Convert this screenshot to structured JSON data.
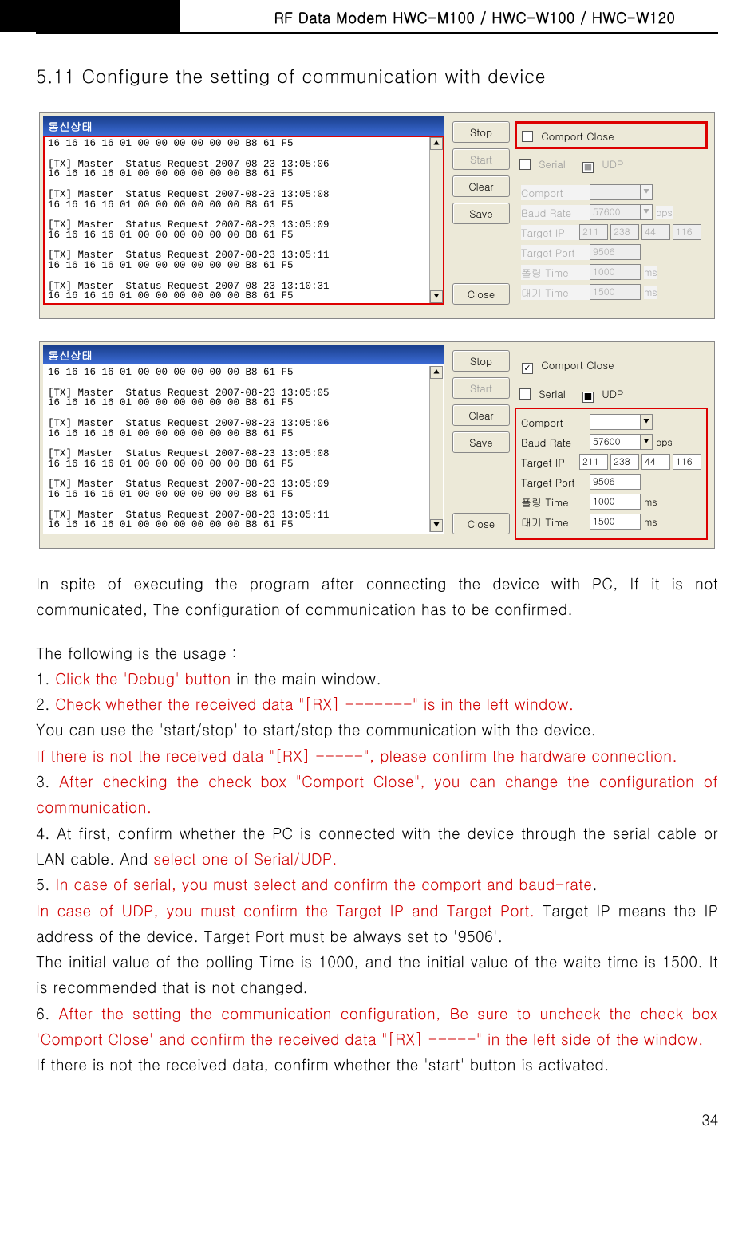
{
  "header": {
    "title": "RF Data Modem HWC-M100 / HWC-W100 / HWC-W120"
  },
  "section_title": "5.11 Configure the setting of communication with device",
  "log_panel_title": "통신상태",
  "log1": "16 16 16 16 01 00 00 00 00 00 00 B8 61 F5\n\n[TX] Master  Status Request 2007-08-23 13:05:06\n16 16 16 16 01 00 00 00 00 00 00 B8 61 F5\n\n[TX] Master  Status Request 2007-08-23 13:05:08\n16 16 16 16 01 00 00 00 00 00 00 B8 61 F5\n\n[TX] Master  Status Request 2007-08-23 13:05:09\n16 16 16 16 01 00 00 00 00 00 00 B8 61 F5\n\n[TX] Master  Status Request 2007-08-23 13:05:11\n16 16 16 16 01 00 00 00 00 00 00 B8 61 F5\n\n[TX] Master  Status Request 2007-08-23 13:10:31\n16 16 16 16 01 00 00 00 00 00 00 B8 61 F5",
  "log2": "16 16 16 16 01 00 00 00 00 00 00 B8 61 F5\n\n[TX] Master  Status Request 2007-08-23 13:05:05\n16 16 16 16 01 00 00 00 00 00 00 B8 61 F5\n\n[TX] Master  Status Request 2007-08-23 13:05:06\n16 16 16 16 01 00 00 00 00 00 00 B8 61 F5\n\n[TX] Master  Status Request 2007-08-23 13:05:08\n16 16 16 16 01 00 00 00 00 00 00 B8 61 F5\n\n[TX] Master  Status Request 2007-08-23 13:05:09\n16 16 16 16 01 00 00 00 00 00 00 B8 61 F5\n\n[TX] Master  Status Request 2007-08-23 13:05:11\n16 16 16 16 01 00 00 00 00 00 00 B8 61 F5",
  "buttons": {
    "stop": "Stop",
    "start": "Start",
    "clear": "Clear",
    "save": "Save",
    "close": "Close"
  },
  "settings": {
    "comport_close": "Comport Close",
    "serial": "Serial",
    "udp": "UDP",
    "comport": "Comport",
    "baud": "Baud Rate",
    "baud_val": "57600",
    "bps": "bps",
    "target_ip": "Target IP",
    "ip": [
      "211",
      "238",
      "44",
      "116"
    ],
    "target_port": "Target Port",
    "port_val": "9506",
    "poll_time": "폴링 Time",
    "poll_val": "1000",
    "wait_time": "대기 Time",
    "wait_val": "1500",
    "ms": "ms"
  },
  "para": {
    "p1a": "In  spite  of  executing  the  program  after  connecting  the  device  with  PC,  If  it  is  not communicated, The configuration of communication has to be confirmed.",
    "p2": "The following is the usage :",
    "p3a": "1. ",
    "p3b": "Click the 'Debug' button",
    "p3c": " in the main window.",
    "p4a": "2. ",
    "p4b": "Check whether the received data \"[RX] -------\" is in the left window.",
    "p5": "   You can use the 'start/stop' to start/stop the communication with the device.",
    "p6": "   If there is not the received data \"[RX] -----\", please confirm the hardware connection.",
    "p7a": "3.  ",
    "p7b": "After  checking  the  check  box  \"Comport  Close\",  you  can  change  the  configuration  of communication.",
    "p8a": "4. At first, confirm whether the PC is connected with the device through the serial cable or LAN cable. And ",
    "p8b": "select one of Serial/UDP.",
    "p9a": "5. ",
    "p9b": "In case of serial, you must select and confirm the comport and baud-rate",
    "p9c": ".",
    "p10a": "   ",
    "p10b": "In case of UDP, you must confirm the Target IP and Target Port.",
    "p10c": " Target IP means the IP address of the device. Target Port must be always set to '9506'.",
    "p11": "   The initial value of the polling Time is 1000, and the initial value of the waite time is 1500. It is recommended that is not changed.",
    "p12a": "6. ",
    "p12b": "After  the  setting  the  communication  configuration,  Be  sure  to  uncheck  the  check  box 'Comport Close' and confirm the received data \"[RX] -----\" in the left side of the window.",
    "p13": "  If there is not the received data, confirm whether the 'start' button is activated."
  },
  "page_number": "34"
}
